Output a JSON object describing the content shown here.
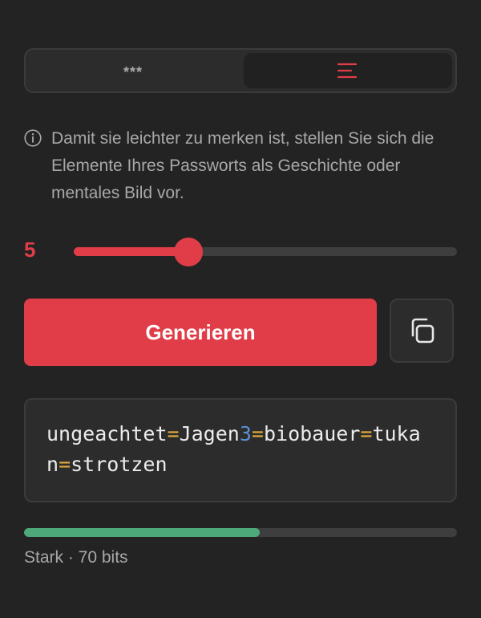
{
  "mode_toggle": {
    "tabs": [
      {
        "label": "***",
        "icon": "asterisks",
        "active": false
      },
      {
        "label": "",
        "icon": "text-lines-icon",
        "active": true
      }
    ]
  },
  "info": {
    "icon": "info-circle-icon",
    "text": "Damit sie leichter zu merken ist, stellen Sie sich die Elemente Ihres Passworts als Geschichte oder mentales Bild vor."
  },
  "length_slider": {
    "value": "5",
    "fill_fraction": 0.3
  },
  "generate_button": {
    "label": "Generieren"
  },
  "copy_button": {
    "icon": "copy-icon"
  },
  "password": {
    "tokens": [
      {
        "text": "ungeachtet",
        "kind": "word"
      },
      {
        "text": "=",
        "kind": "sep"
      },
      {
        "text": "Jagen",
        "kind": "word"
      },
      {
        "text": "3",
        "kind": "num"
      },
      {
        "text": "=",
        "kind": "sep"
      },
      {
        "text": "biobauer",
        "kind": "word"
      },
      {
        "text": "=",
        "kind": "sep"
      },
      {
        "text": "tukan",
        "kind": "word"
      },
      {
        "text": "=",
        "kind": "sep"
      },
      {
        "text": "strotzen",
        "kind": "word"
      }
    ]
  },
  "strength": {
    "label": "Stark · 70 bits",
    "fraction": 0.545
  },
  "colors": {
    "accent": "#e03d48",
    "background": "#232323",
    "separator": "#e2ad3b",
    "number": "#5b8fd6",
    "strength": "#4ea97a"
  }
}
